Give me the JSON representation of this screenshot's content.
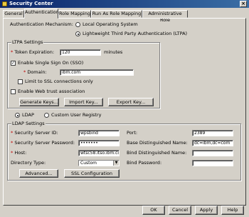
{
  "window": {
    "title": "Security Center",
    "close_glyph": "×"
  },
  "tabs": [
    "General",
    "Authentication",
    "Role Mapping",
    "Run As Role Mapping",
    "Administrative Role"
  ],
  "active_tab": "Authentication",
  "auth": {
    "mechanism_label": "Authentication Mechanism:",
    "options": [
      "Local Operating System",
      "Lightweight Third Party Authentication (LTPA)"
    ],
    "selected": "Lightweight Third Party Authentication (LTPA)"
  },
  "ltpa": {
    "title": "LTPA Settings",
    "token_label": "Token Expiration:",
    "token_value": "120",
    "token_unit": "minutes",
    "sso_label": "Enable Single Sign On (SSO)",
    "sso_checked": true,
    "domain_label": "Domain:",
    "domain_value": "ibm.com",
    "ssl_only_label": "Limit to SSL connections only",
    "ssl_only_checked": false,
    "web_trust_label": "Enable Web trust association",
    "web_trust_checked": false,
    "buttons": [
      "Generate Keys...",
      "Import Key...",
      "Export Key..."
    ]
  },
  "registry": {
    "options": [
      "LDAP",
      "Custom User Registry"
    ],
    "selected": "LDAP"
  },
  "ldap": {
    "title": "LDAP Settings",
    "server_id_label": "Security Server ID:",
    "server_id_value": "wpsbind",
    "password_label": "Security Server Password:",
    "password_value": "•••••••",
    "host_label": "Host:",
    "host_value": "wtsc58.itso.ibm.com",
    "dir_type_label": "Directory Type:",
    "dir_type_value": "Custom",
    "port_label": "Port:",
    "port_value": "2389",
    "base_dn_label": "Base Distinguished Name:",
    "base_dn_value": "dc=ibm,dc=com",
    "bind_dn_label": "Bind Distinguished Name:",
    "bind_dn_value": "",
    "bind_pw_label": "Bind Password:",
    "bind_pw_value": "",
    "advanced_button": "Advanced...",
    "ssl_button": "SSL Configuration"
  },
  "footer": {
    "buttons": [
      "OK",
      "Cancel",
      "Apply",
      "Help"
    ]
  },
  "required_marker": "*",
  "colors": {
    "titlebar_start": "#0a246a",
    "titlebar_end": "#3a6ea5",
    "face": "#d4d0c8",
    "required": "#c00000"
  },
  "icons": {
    "title": "security-center-icon",
    "dropdown": "chevron-down-icon",
    "check": "checkmark-icon"
  }
}
